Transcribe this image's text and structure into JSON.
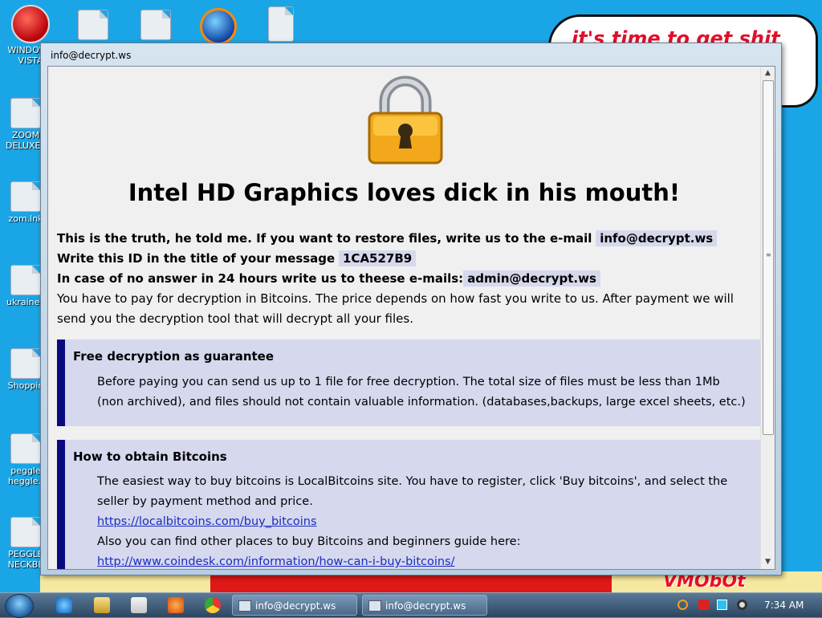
{
  "desktop": {
    "wallpaper_text": "it's time to get shit",
    "wallpaper_logo": "VMObOt",
    "icons": [
      {
        "label": "WINDOWS\nVISTA",
        "icon": "vista-icon"
      },
      {
        "label": "",
        "icon": "file-icon"
      },
      {
        "label": "",
        "icon": "file-icon"
      },
      {
        "label": "",
        "icon": "globe-icon"
      },
      {
        "label": "",
        "icon": "document-icon"
      },
      {
        "label": "ZOOM\nDELUXE.l",
        "icon": "file-icon"
      },
      {
        "label": "zom.lnk",
        "icon": "file-icon"
      },
      {
        "label": "ukraine.l",
        "icon": "file-icon"
      },
      {
        "label": "Shoppin",
        "icon": "file-icon"
      },
      {
        "label": "peggle\nheggle.l",
        "icon": "file-icon"
      },
      {
        "label": "PEGGLE\nNECKBE",
        "icon": "file-icon"
      }
    ]
  },
  "window": {
    "title": "info@decrypt.ws"
  },
  "note": {
    "heading": "Intel HD Graphics loves dick in his mouth!",
    "line1_text": "This is the truth, he told me. If you want to restore files, write us to the e-mail",
    "line1_email": "info@decrypt.ws",
    "line2_text": "Write this ID in the title of your message",
    "line2_id": "1CA527B9",
    "line3_text": "In case of no answer in 24 hours write us to theese e-mails:",
    "line3_email": "admin@decrypt.ws",
    "pay_text": "You have to pay for decryption in Bitcoins. The price depends on how fast you write to us. After payment we will send you the decryption tool that will decrypt all your files.",
    "box1": {
      "title": "Free decryption as guarantee",
      "text": "Before paying you can send us up to 1 file for free decryption. The total size of files must be less than 1Mb (non archived), and files should not contain valuable information. (databases,backups, large excel sheets, etc.)"
    },
    "box2": {
      "title": "How to obtain Bitcoins",
      "text1": "The easiest way to buy bitcoins is LocalBitcoins site. You have to register, click 'Buy bitcoins', and select the seller by payment method and price.",
      "link1": "https://localbitcoins.com/buy_bitcoins",
      "text2": "Also you can find other places to buy Bitcoins and beginners guide here:",
      "link2": "http://www.coindesk.com/information/how-can-i-buy-bitcoins/"
    }
  },
  "taskbar": {
    "tasks": [
      "info@decrypt.ws",
      "info@decrypt.ws"
    ],
    "clock": "7:34 AM"
  }
}
